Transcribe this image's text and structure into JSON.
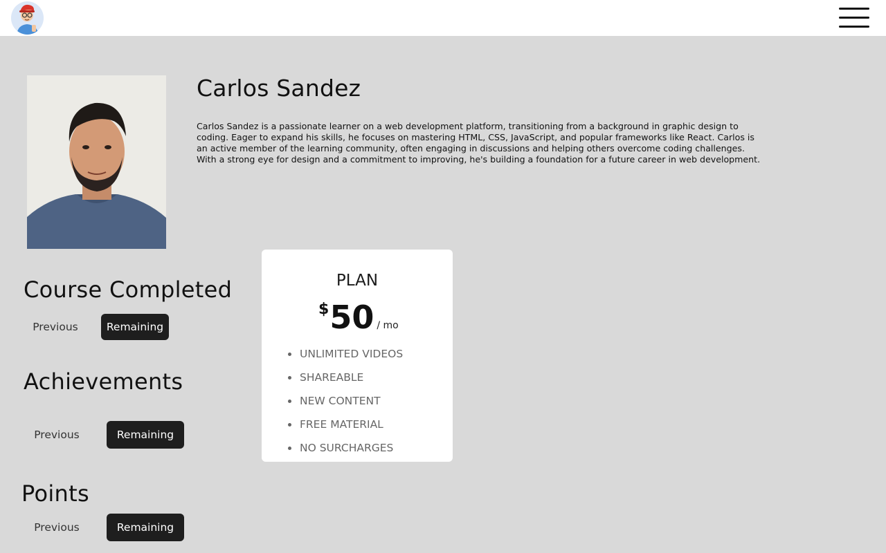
{
  "profile": {
    "name": "Carlos Sandez",
    "bio": "Carlos Sandez is a passionate learner on a web development platform, transitioning from a background in graphic design to coding. Eager to expand his skills, he focuses on mastering HTML, CSS, JavaScript, and popular frameworks like React. Carlos is an active member of the learning community, often engaging in discussions and helping others overcome coding challenges. With a strong eye for design and a commitment to improving, he's building a foundation for a future career in web development."
  },
  "sections": {
    "course": {
      "title": "Course Completed",
      "previous_label": "Previous",
      "remaining_label": "Remaining"
    },
    "achievements": {
      "title": "Achievements",
      "previous_label": "Previous",
      "remaining_label": "Remaining"
    },
    "points": {
      "title": "Points",
      "previous_label": "Previous",
      "remaining_label": "Remaining"
    }
  },
  "plan": {
    "title": "PLAN",
    "currency": "$",
    "amount": "50",
    "period": "/ mo",
    "features": [
      "UNLIMITED VIDEOS",
      "SHAREABLE",
      "NEW CONTENT",
      "FREE MATERIAL",
      "NO SURCHARGES"
    ]
  },
  "icons": {
    "logo": "avatar-cartoon-logo",
    "menu": "hamburger-menu-icon"
  },
  "colors": {
    "page_bg": "#d9d9d9",
    "topbar_bg": "#ffffff",
    "dark_button": "#1e1e1e",
    "card_bg": "#ffffff"
  }
}
